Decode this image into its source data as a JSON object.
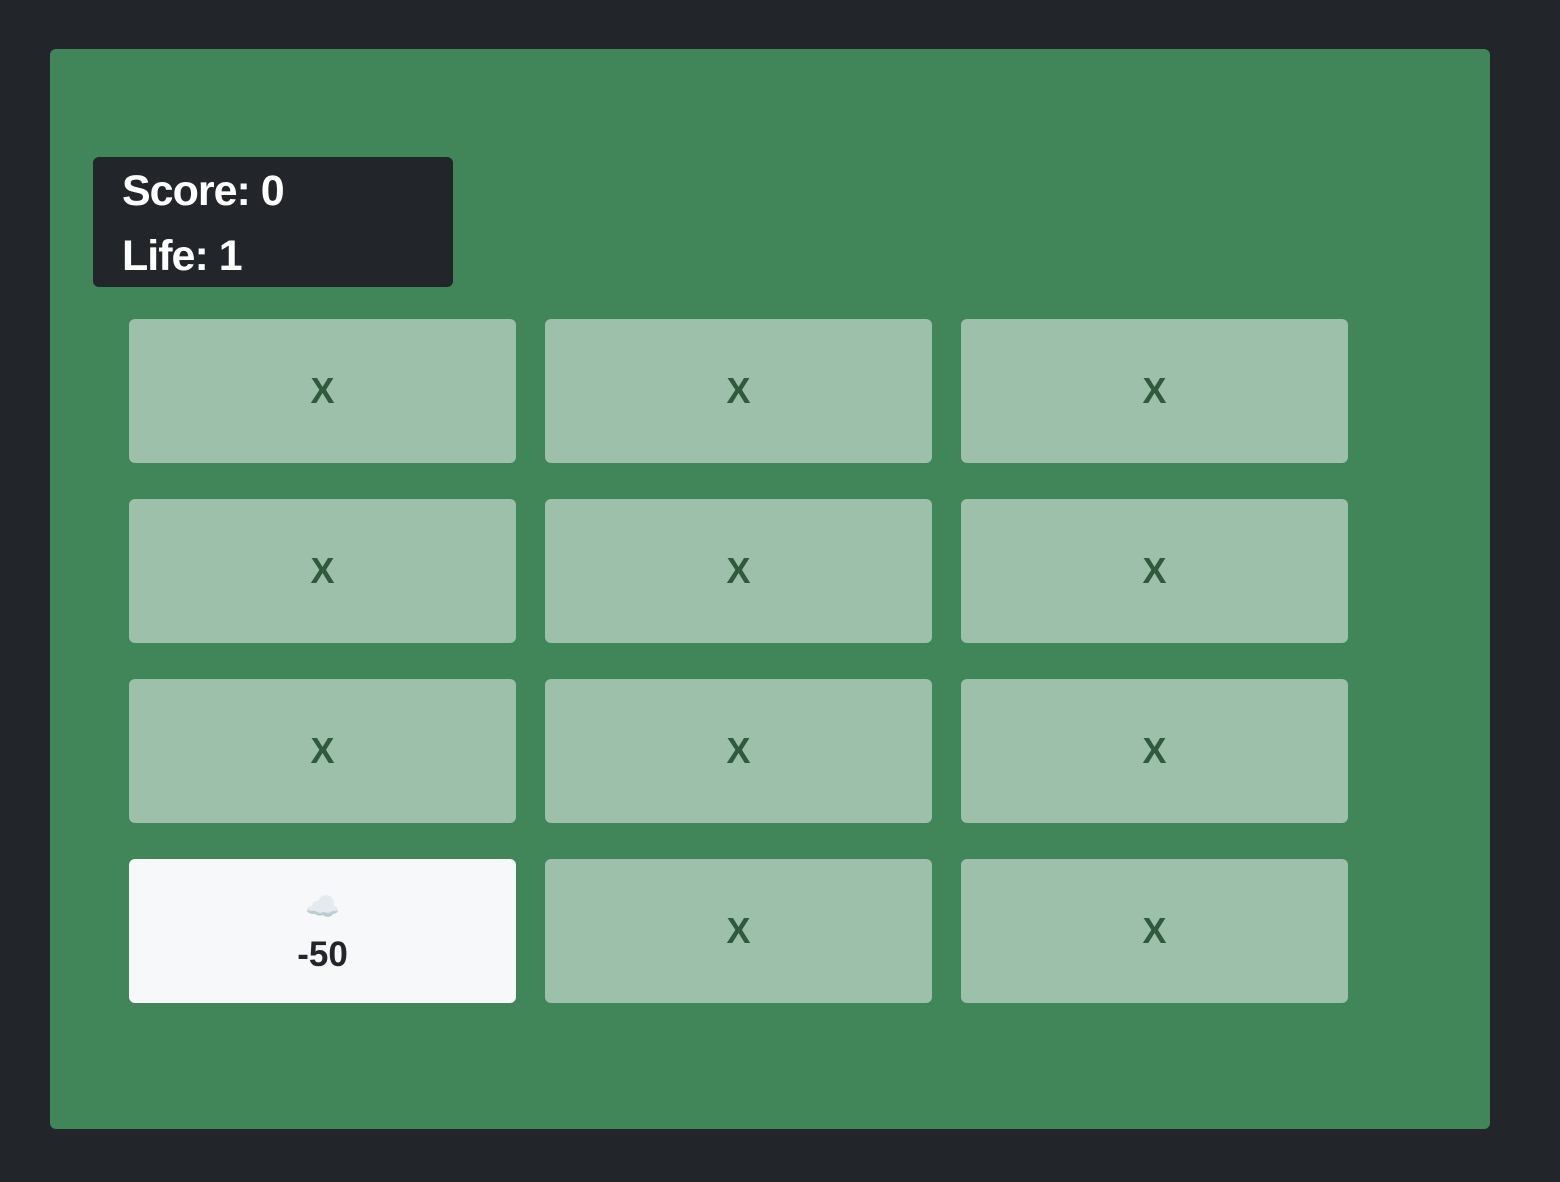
{
  "status": {
    "score_text": "Score: 0",
    "life_text": "Life: 1"
  },
  "cells": [
    {
      "label": "X"
    },
    {
      "label": "X"
    },
    {
      "label": "X"
    },
    {
      "label": "X"
    },
    {
      "label": "X"
    },
    {
      "label": "X"
    },
    {
      "label": "X"
    },
    {
      "label": "X"
    },
    {
      "label": "X"
    },
    {
      "emoji": "☁️",
      "value": "-50",
      "icon": "cloud-icon"
    },
    {
      "label": "X"
    },
    {
      "label": "X"
    }
  ],
  "colors": {
    "background": "#22252a",
    "board": "#418658",
    "tile_hidden": "#9cc0aa",
    "tile_revealed": "#f7f8fa",
    "mark": "#2f5a3d"
  }
}
